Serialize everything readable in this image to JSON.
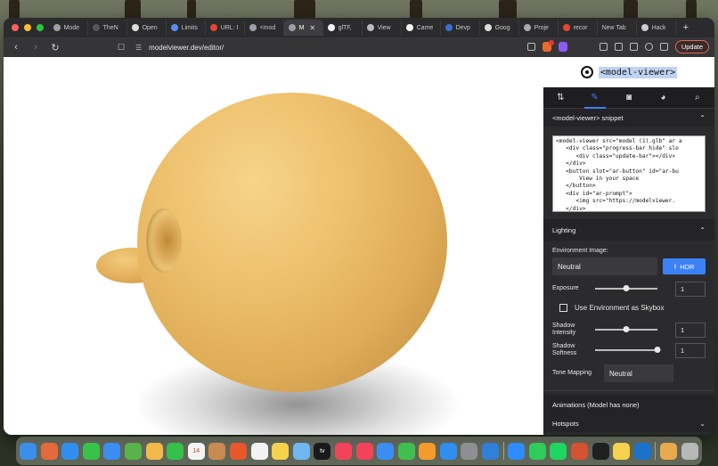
{
  "browser": {
    "tabs": [
      {
        "label": "Mode",
        "icon": "cube-icon",
        "color": "#9aa0a6"
      },
      {
        "label": "TheN",
        "icon": "tab-icon",
        "color": "#555555"
      },
      {
        "label": "Open",
        "icon": "openai-icon",
        "color": "#dddddd"
      },
      {
        "label": "Limits",
        "icon": "globe-icon",
        "color": "#5b8def"
      },
      {
        "label": "URL: I",
        "icon": "google-icon",
        "color": "#ea4335"
      },
      {
        "label": "<mod",
        "icon": "cube-icon",
        "color": "#9aa0a6"
      },
      {
        "label": "M",
        "icon": "cube-icon",
        "color": "#9aa0a6",
        "active": true
      },
      {
        "label": "glTF,",
        "icon": "snapchat-icon",
        "color": "#f5f5f5"
      },
      {
        "label": "View",
        "icon": "home-icon",
        "color": "#bbbbbb"
      },
      {
        "label": "Came",
        "icon": "snapchat-icon",
        "color": "#f5f5f5"
      },
      {
        "label": "Devp",
        "icon": "d-icon",
        "color": "#3b6fd4"
      },
      {
        "label": "Goog",
        "icon": "docs-icon",
        "color": "#dddddd"
      },
      {
        "label": "Proje",
        "icon": "gear-icon",
        "color": "#aaaaaa"
      },
      {
        "label": "recor",
        "icon": "google-icon",
        "color": "#ea4335"
      },
      {
        "label": "New Tab",
        "icon": "",
        "color": "#2b2b2e"
      },
      {
        "label": "Hack",
        "icon": "hack-icon",
        "color": "#cccccc"
      }
    ],
    "url": "modelviewer.dev/editor/",
    "update_label": "Update",
    "extension_badge": "1"
  },
  "editor": {
    "brand_text": "<model-viewer>",
    "tabs": [
      {
        "name": "edit-tab",
        "glyph": "⇅",
        "icon": "sort-icon"
      },
      {
        "name": "brush-tab",
        "glyph": "✎",
        "icon": "brush-icon",
        "active": true
      },
      {
        "name": "camera-tab",
        "glyph": "◙",
        "icon": "camera-icon"
      },
      {
        "name": "palette-tab",
        "glyph": "◕",
        "icon": "palette-icon"
      },
      {
        "name": "search-tab",
        "glyph": "⌕",
        "icon": "search-icon"
      }
    ],
    "snippet_title": "<model-viewer> snippet",
    "snippet_code": "<model-viewer src=\"model (1).glb\" ar a\n   <div class=\"progress-bar hide\" slo\n      <div class=\"update-bar\"></div>\n   </div>\n   <button slot=\"ar-button\" id=\"ar-bu\n       View in your space\n   </button>\n   <div id=\"ar-prompt\">\n      <img src=\"https://modelviewer.\n   </div>",
    "lighting_title": "Lighting",
    "env_image_label": "Environment Image:",
    "env_select_value": "Neutral",
    "hdr_label": "HDR",
    "exposure_label": "Exposure",
    "exposure_value": "1",
    "exposure_fraction": 0.5,
    "skybox_label": "Use Environment as Skybox",
    "shadow_intensity_label": "Shadow Intensity",
    "shadow_intensity_value": "1",
    "shadow_intensity_fraction": 0.5,
    "shadow_softness_label": "Shadow Softness",
    "shadow_softness_value": "1",
    "shadow_softness_fraction": 1.0,
    "tone_mapping_label": "Tone Mapping",
    "tone_mapping_value": "Neutral",
    "animations_title": "Animations (Model has none)",
    "hotspots_title": "Hotspots"
  },
  "dock": [
    {
      "icon": "finder-icon",
      "color": "#3b8eea"
    },
    {
      "icon": "launchpad-icon",
      "color": "#e46a3c"
    },
    {
      "icon": "safari-icon",
      "color": "#2f8ef0"
    },
    {
      "icon": "messages-icon",
      "color": "#39c24a"
    },
    {
      "icon": "mail-icon",
      "color": "#3a8ef2"
    },
    {
      "icon": "maps-icon",
      "color": "#58b34b"
    },
    {
      "icon": "photos-icon",
      "color": "#f2b84a"
    },
    {
      "icon": "facetime-icon",
      "color": "#35c04c"
    },
    {
      "icon": "calendar-icon",
      "color": "#f4f4f4",
      "label": "14"
    },
    {
      "icon": "contacts-icon",
      "color": "#c98a4f"
    },
    {
      "icon": "brave-icon",
      "color": "#e8572b"
    },
    {
      "icon": "reminders-icon",
      "color": "#f2f2f2"
    },
    {
      "icon": "notes-icon",
      "color": "#f7d24c"
    },
    {
      "icon": "freeform-icon",
      "color": "#6fb7f0"
    },
    {
      "icon": "tv-icon",
      "color": "#1a1a1a",
      "label": "tv"
    },
    {
      "icon": "music-icon",
      "color": "#f2435b"
    },
    {
      "icon": "news-icon",
      "color": "#f2435b"
    },
    {
      "icon": "keynote-icon",
      "color": "#3a8ef2"
    },
    {
      "icon": "numbers-icon",
      "color": "#3fbf4e"
    },
    {
      "icon": "pages-icon",
      "color": "#f39b2b"
    },
    {
      "icon": "appstore-icon",
      "color": "#2f8ef0"
    },
    {
      "icon": "settings-icon",
      "color": "#8e8e93"
    },
    {
      "icon": "vscode-icon",
      "color": "#2f80d6"
    },
    {
      "icon": "zoom-icon",
      "color": "#2d8cff"
    },
    {
      "icon": "whatsapp-icon",
      "color": "#2fcc5a"
    },
    {
      "icon": "spotify-icon",
      "color": "#1ed760"
    },
    {
      "icon": "powerpoint-icon",
      "color": "#d35230"
    },
    {
      "icon": "terminal-icon",
      "color": "#202020"
    },
    {
      "icon": "stickies-icon",
      "color": "#f7d24c"
    },
    {
      "icon": "outlook-icon",
      "color": "#1a73c8"
    },
    {
      "icon": "preview-icon",
      "color": "#e9a94a"
    },
    {
      "icon": "trash-icon",
      "color": "#b8b8b8"
    }
  ]
}
